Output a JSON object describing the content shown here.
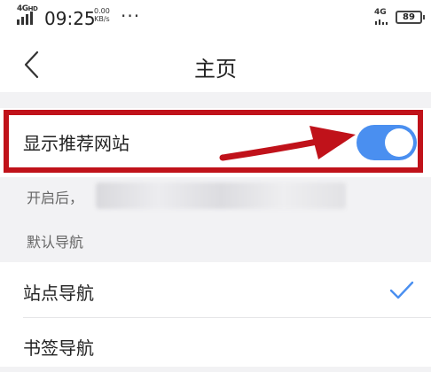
{
  "status_bar": {
    "network": "4G",
    "network_sup": "HD",
    "time": "09:25",
    "speed_value": "0.00",
    "speed_unit": "KB/s",
    "more": "···",
    "right_network": "4G",
    "battery": "89"
  },
  "header": {
    "title": "主页",
    "back_icon": "chevron-left-icon"
  },
  "settings": {
    "recommend_label": "显示推荐网站",
    "recommend_enabled": true,
    "description_prefix": "开启后，",
    "nav_section_title": "默认导航",
    "nav_options": [
      {
        "label": "站点导航",
        "selected": true
      },
      {
        "label": "书签导航",
        "selected": false
      }
    ]
  },
  "colors": {
    "toggle_on": "#4a8ff0",
    "annotation_red": "#c0121a",
    "check": "#4a8ff0"
  }
}
